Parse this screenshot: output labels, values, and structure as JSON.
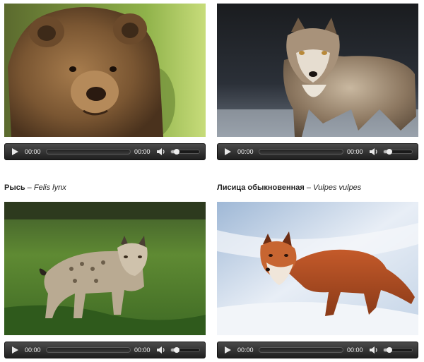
{
  "cards": [
    {
      "animal": "bear",
      "caption": null,
      "player": {
        "current_time": "00:00",
        "duration": "00:00",
        "progress": 0,
        "volume": 0.15
      }
    },
    {
      "animal": "wolf",
      "caption": null,
      "player": {
        "current_time": "00:00",
        "duration": "00:00",
        "progress": 0,
        "volume": 0.15
      }
    },
    {
      "animal": "lynx",
      "caption": {
        "common_name": "Рысь",
        "separator": " – ",
        "latin_name": "Felis lynx"
      },
      "player": {
        "current_time": "00:00",
        "duration": "00:00",
        "progress": 0,
        "volume": 0.15
      }
    },
    {
      "animal": "fox",
      "caption": {
        "common_name": "Лисица обыкновенная",
        "separator": " – ",
        "latin_name": "Vulpes vulpes"
      },
      "player": {
        "current_time": "00:00",
        "duration": "00:00",
        "progress": 0,
        "volume": 0.15
      }
    }
  ],
  "icons": {
    "play": "play-icon",
    "volume": "speaker-volume-icon"
  },
  "colors": {
    "player_bg": "#2e2e2e",
    "player_text": "#f0f0f0"
  }
}
